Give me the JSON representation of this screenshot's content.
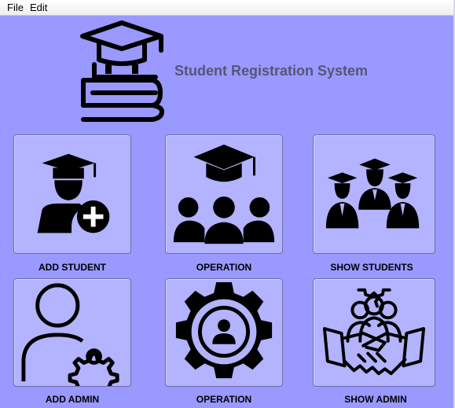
{
  "menubar": {
    "items": [
      "File",
      "Edit"
    ]
  },
  "header": {
    "title": "Student Registration System",
    "logo_icon": "graduation-cap-books-icon"
  },
  "tiles": [
    {
      "label": "ADD STUDENT",
      "icon": "add-student-icon"
    },
    {
      "label": "OPERATION",
      "icon": "graduate-group-icon"
    },
    {
      "label": "SHOW STUDENTS",
      "icon": "students-in-caps-icon"
    },
    {
      "label": "ADD ADMIN",
      "icon": "user-gear-icon"
    },
    {
      "label": "OPERATION",
      "icon": "gear-user-icon"
    },
    {
      "label": "SHOW ADMIN",
      "icon": "handshake-team-icon"
    }
  ],
  "colors": {
    "background": "#9999ff",
    "tile": "#b3b3ff",
    "title": "#555578"
  }
}
